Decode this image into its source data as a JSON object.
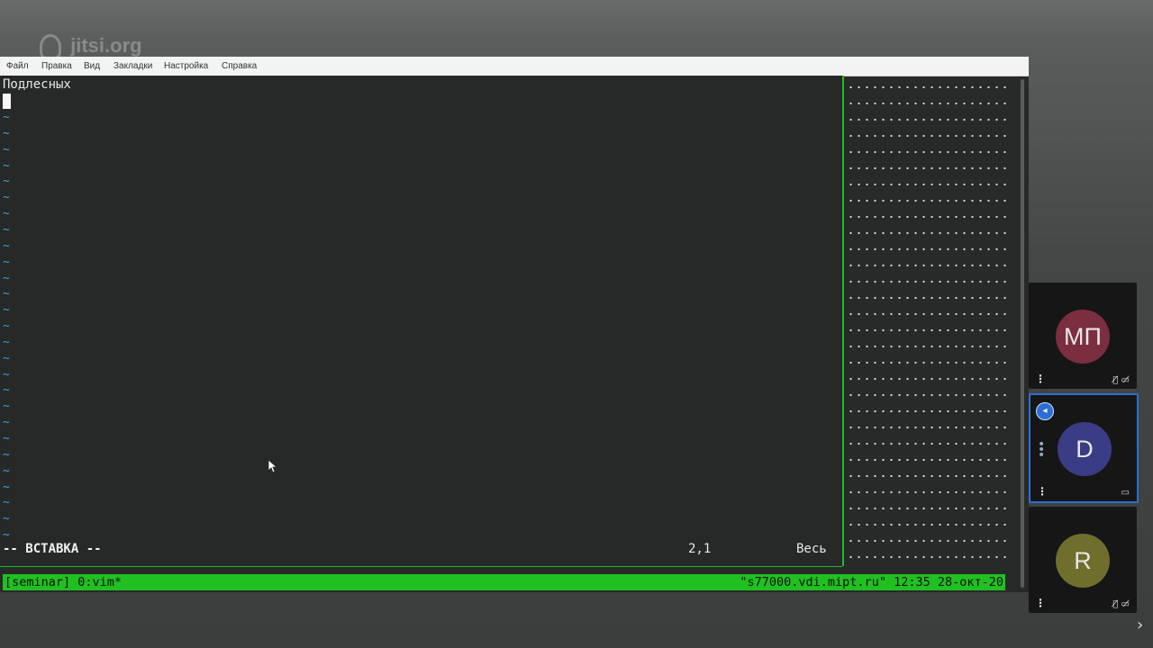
{
  "watermark": {
    "text": "jitsi.org"
  },
  "menubar": {
    "items": [
      "Файл",
      "Правка",
      "Вид",
      "Закладки",
      "Настройка",
      "Справка"
    ]
  },
  "editor": {
    "first_line": "Подлесных",
    "tilde": "~",
    "mode": "-- ВСТАВКА --",
    "position": "2,1",
    "scroll": "Весь"
  },
  "tmux": {
    "left": "[seminar] 0:vim*",
    "right": "\"s77000.vdi.mipt.ru\" 12:35 28-окт-20"
  },
  "participants": [
    {
      "initials": "МП",
      "color": "#7b2e40",
      "muted": true,
      "video_off": true
    },
    {
      "initials": "D",
      "color": "#3a3c86",
      "speaking": true,
      "screen_share": true
    },
    {
      "initials": "R",
      "color": "#6f6e2d",
      "muted": true,
      "video_off": true
    }
  ],
  "colors": {
    "tmux_green": "#21c021",
    "tilde_blue": "#3aa0e6",
    "active_border": "#2b6fd6"
  },
  "icons": [
    "mic-off-icon",
    "video-off-icon",
    "screen-share-icon",
    "speaker-icon",
    "kebab-menu-icon",
    "chevron-right-icon"
  ]
}
